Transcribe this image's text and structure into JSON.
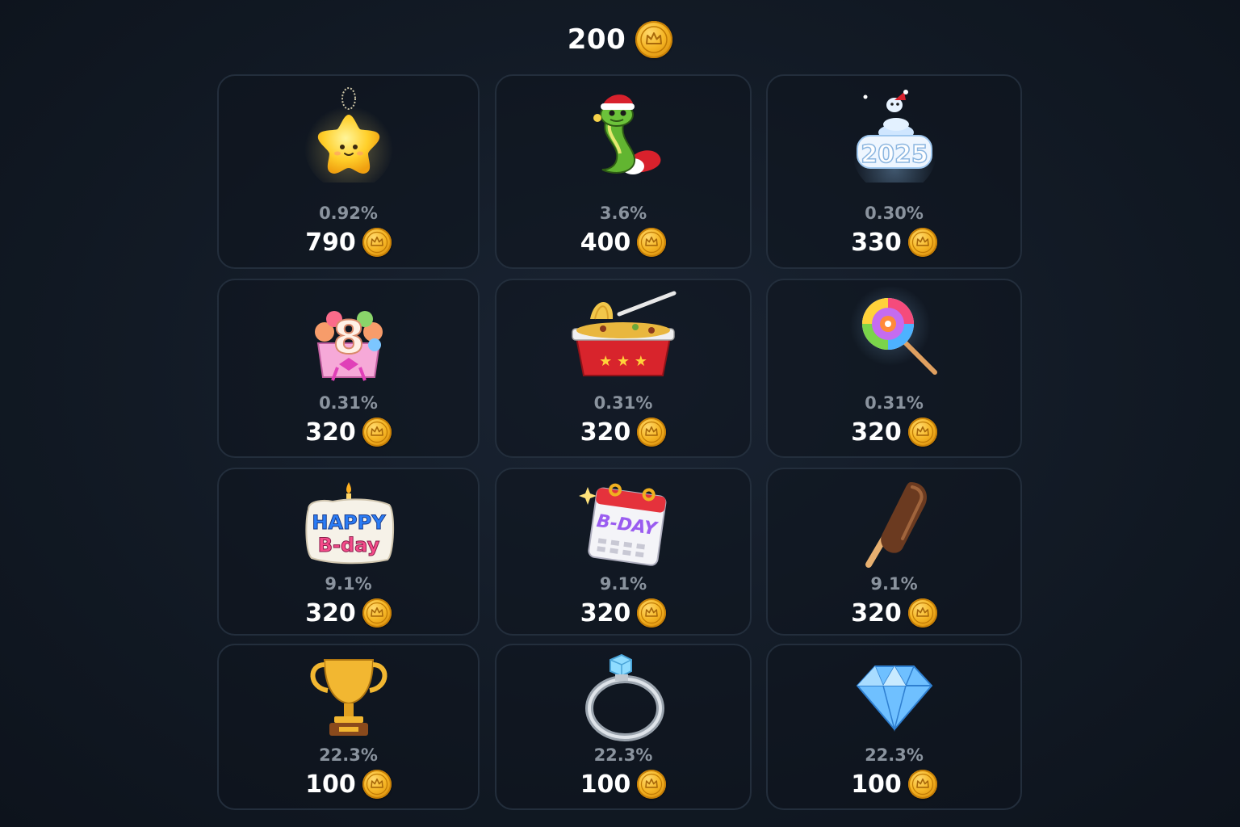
{
  "balance": {
    "amount": "200",
    "currency_icon": "crown-coin-icon"
  },
  "items": [
    {
      "name_icon": "star-keychain-icon",
      "chance": "0.92%",
      "price": "790"
    },
    {
      "name_icon": "snake-santa-hat-icon",
      "chance": "3.6%",
      "price": "400"
    },
    {
      "name_icon": "snow-snake-2025-icon",
      "chance": "0.30%",
      "price": "330"
    },
    {
      "name_icon": "flower-cake-8-icon",
      "chance": "0.31%",
      "price": "320"
    },
    {
      "name_icon": "noodle-box-icon",
      "chance": "0.31%",
      "price": "320"
    },
    {
      "name_icon": "lollipop-icon",
      "chance": "0.31%",
      "price": "320"
    },
    {
      "name_icon": "happy-bday-cake-icon",
      "chance": "9.1%",
      "price": "320"
    },
    {
      "name_icon": "bday-calendar-icon",
      "chance": "9.1%",
      "price": "320"
    },
    {
      "name_icon": "chocolate-popsicle-icon",
      "chance": "9.1%",
      "price": "320"
    },
    {
      "name_icon": "trophy-icon",
      "chance": "22.3%",
      "price": "100"
    },
    {
      "name_icon": "diamond-ring-icon",
      "chance": "22.3%",
      "price": "100"
    },
    {
      "name_icon": "diamond-icon",
      "chance": "22.3%",
      "price": "100"
    }
  ],
  "sticker_text": {
    "year": "2025",
    "happy": "HAPPY",
    "bday": "B-day",
    "calendar": "B-DAY",
    "digit": "8"
  },
  "colors": {
    "background": "#121a25",
    "card_border": "#232e3c",
    "coin": "#f5b524",
    "percent_text": "#8a939e"
  }
}
